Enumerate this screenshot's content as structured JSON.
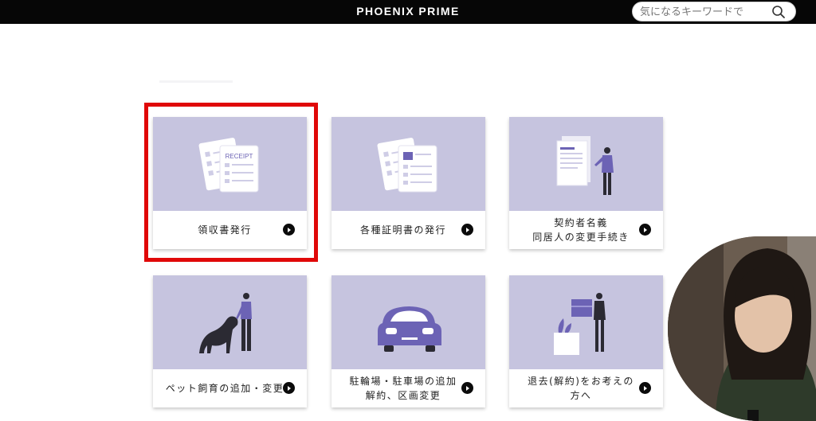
{
  "header": {
    "brand": "PHOENIX PRIME",
    "search_placeholder": "気になるキーワードで",
    "search_icon": "search-icon"
  },
  "receipt_art_text": "RECEIPT",
  "cards": [
    {
      "label": "領収書発行",
      "icon": "receipt-documents-icon",
      "highlighted": true
    },
    {
      "label": "各種証明書の発行",
      "icon": "certificate-documents-icon"
    },
    {
      "label": "契約者名義\n同居人の変更手続き",
      "icon": "person-signing-contract-icon"
    },
    {
      "label": "ペット飼育の追加・変更",
      "icon": "person-with-dog-icon"
    },
    {
      "label": "駐輪場・駐車場の追加\n解約、区画変更",
      "icon": "car-icon"
    },
    {
      "label": "退去(解約)をお考えの\n方へ",
      "icon": "person-carrying-box-icon"
    }
  ],
  "colors": {
    "topbar": "#060606",
    "card_art_bg": "#c6c4df",
    "illustration_accent": "#6c63b5",
    "highlight_border": "#e00808"
  }
}
